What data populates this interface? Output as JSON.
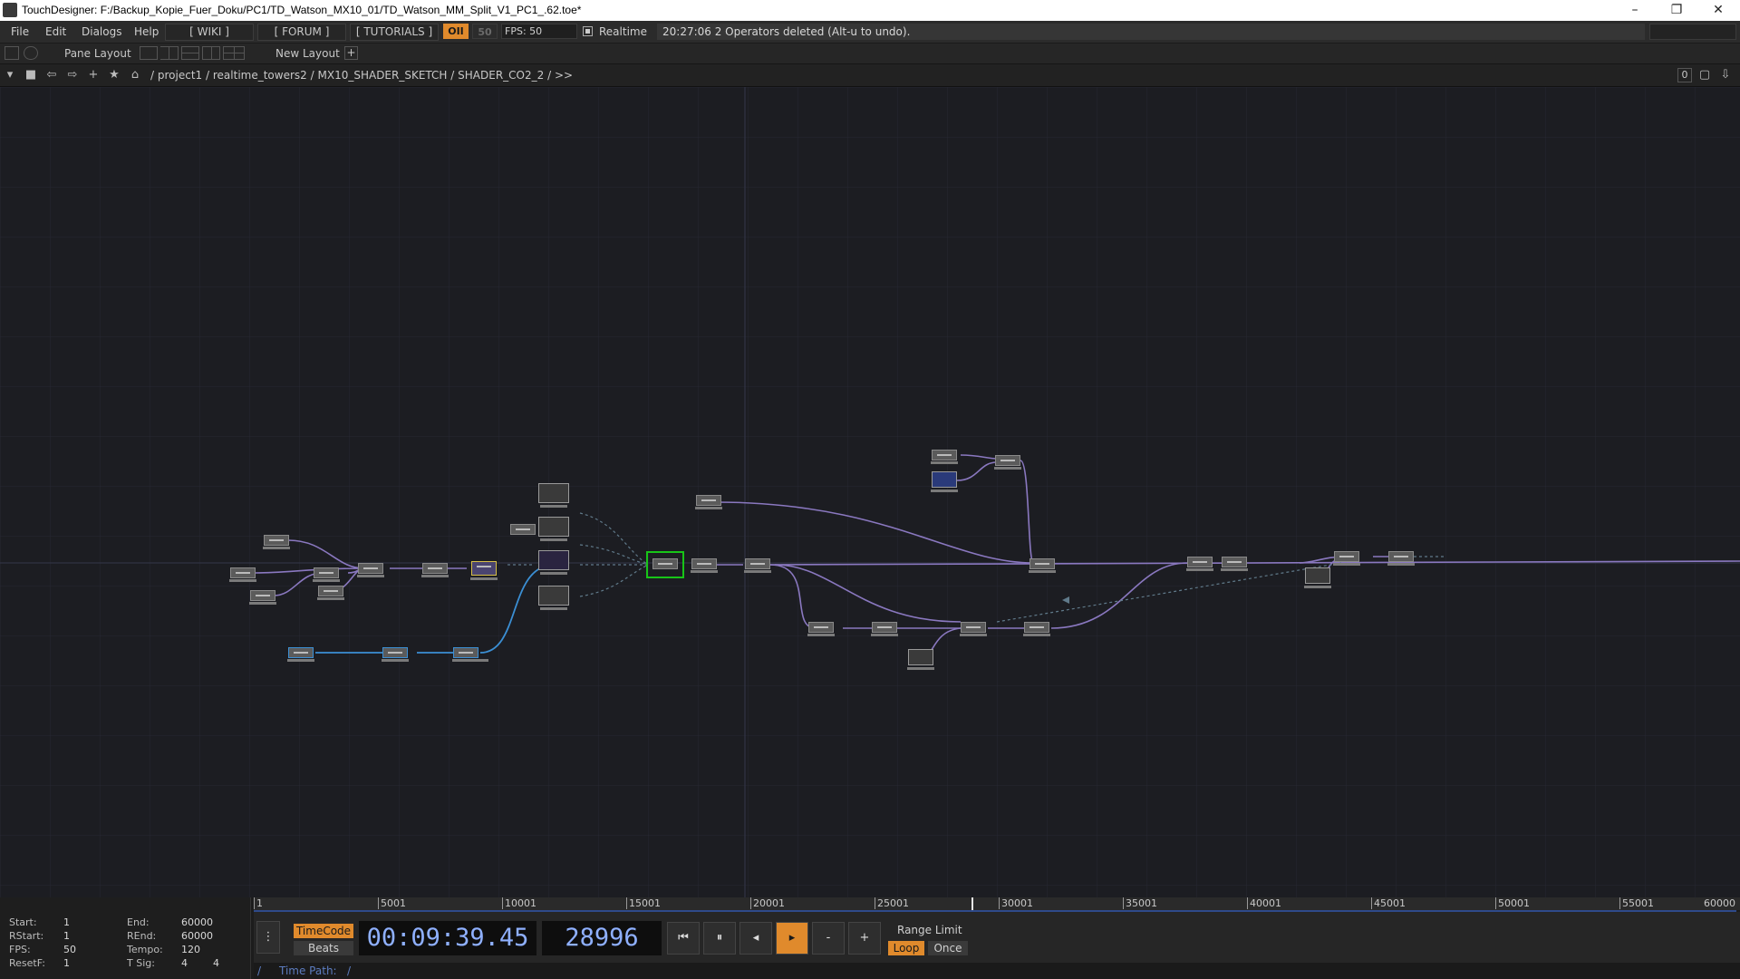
{
  "window": {
    "title": "TouchDesigner: F:/Backup_Kopie_Fuer_Doku/PC1/TD_Watson_MX10_01/TD_Watson_MM_Split_V1_PC1_.62.toe*",
    "minimize": "–",
    "restore": "❐",
    "close": "✕"
  },
  "menu": {
    "file": "File",
    "edit": "Edit",
    "dialogs": "Dialogs",
    "help": "Help",
    "wiki": "[ WIKI ]",
    "forum": "[ FORUM ]",
    "tutorials": "[ TUTORIALS ]",
    "perform_toggle": "OII",
    "fps_target": "50",
    "fps": "FPS:  50",
    "realtime": "Realtime",
    "status": "20:27:06 2 Operators deleted (Alt-u to undo)."
  },
  "panebar": {
    "pane_layout": "Pane Layout",
    "new_layout": "New Layout",
    "add": "+"
  },
  "pathbar": {
    "path": [
      "/",
      "project1",
      "/",
      "realtime_towers2",
      "/",
      "MX10_SHADER_SKETCH",
      "/",
      "SHADER_CO2_2",
      "/",
      ">>"
    ],
    "right_num": "0"
  },
  "timeline": {
    "ruler_ticks": [
      "1",
      "5001",
      "10001",
      "15001",
      "20001",
      "25001",
      "30001",
      "35001",
      "40001",
      "45001",
      "50001",
      "55001",
      "60000"
    ],
    "info": {
      "start_label": "Start:",
      "start": "1",
      "end_label": "End:",
      "end": "60000",
      "rstart_label": "RStart:",
      "rstart": "1",
      "rend_label": "REnd:",
      "rend": "60000",
      "fps_label": "FPS:",
      "fps": "50",
      "tempo_label": "Tempo:",
      "tempo": "120",
      "resetf_label": "ResetF:",
      "resetf": "1",
      "tsig_label": "T Sig:",
      "tsig1": "4",
      "tsig2": "4"
    },
    "timecode_btn": "TimeCode",
    "beats_btn": "Beats",
    "timecode": "00:09:39.45",
    "frame": "28996",
    "range_limit": "Range Limit",
    "loop": "Loop",
    "once": "Once",
    "minus": "-",
    "plus": "+",
    "time_path_label": "Time Path:",
    "time_path": "/"
  },
  "colors": {
    "accent_orange": "#e08a2c",
    "wire_purple": "#8a78c0",
    "wire_blue": "#3b8fd4",
    "selected_green": "#18c418"
  }
}
